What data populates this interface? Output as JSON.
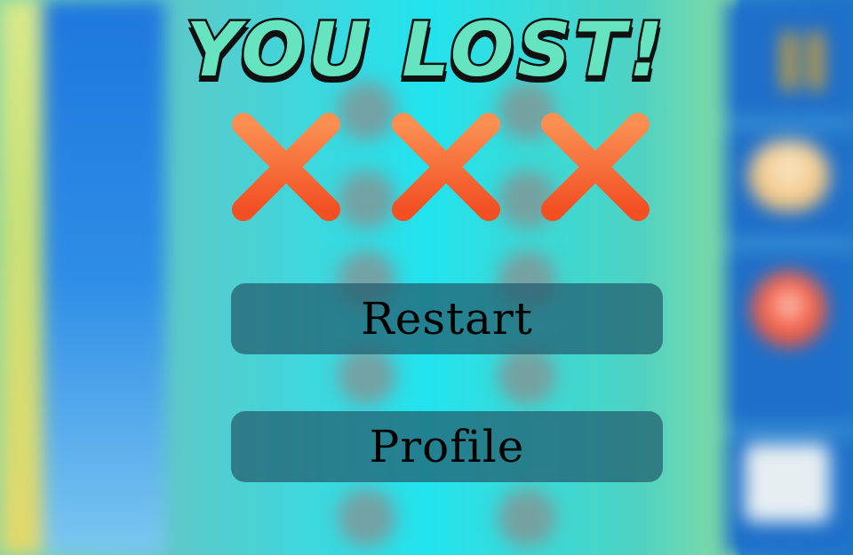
{
  "overlay": {
    "title": "YOU LOST!",
    "strikes": 3,
    "restart_label": "Restart",
    "profile_label": "Profile"
  },
  "colors": {
    "title_fill": "#66e3bf",
    "title_outline": "#111111",
    "strike_top": "#fb8f52",
    "strike_bottom": "#f24f22",
    "button_bg": "#225c6e",
    "board_bg": "#22e3ee",
    "side_panel": "#1e6fc9",
    "pause_icon": "#d9a12e"
  },
  "icons": {
    "strike": "x-mark-icon",
    "pause": "pause-icon",
    "powerup_1": "cake-icon",
    "powerup_2": "bomb-icon",
    "powerup_3": "blank-tile-icon"
  }
}
